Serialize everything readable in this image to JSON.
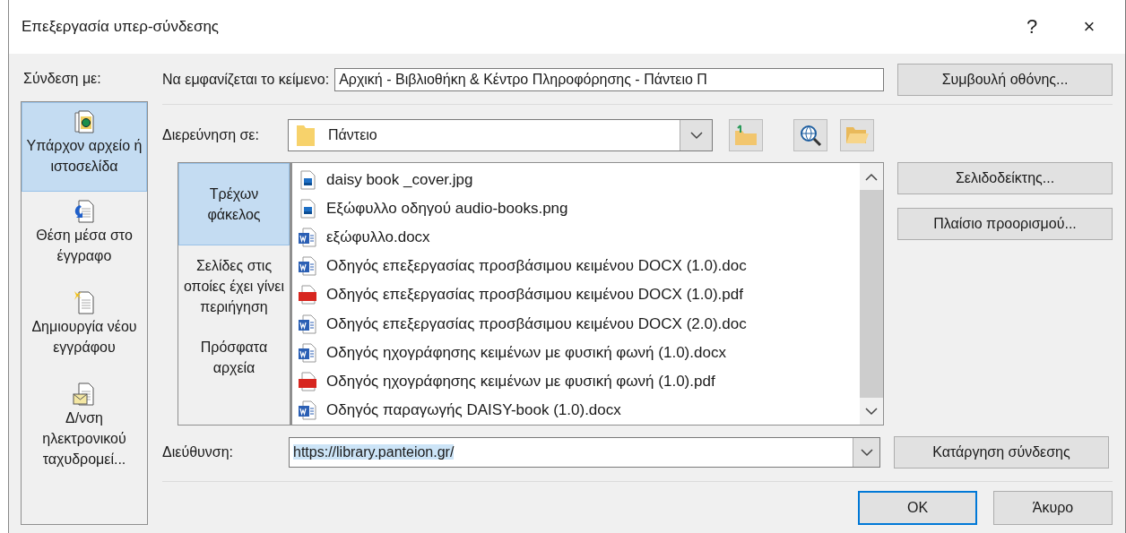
{
  "window": {
    "title": "Επεξεργασία υπερ-σύνδεσης",
    "help": "?",
    "close": "×"
  },
  "link_to": {
    "label": "Σύνδεση με:",
    "items": [
      {
        "label": "Υπάρχον αρχείο ή ιστοσελίδα",
        "kind": "web",
        "selected": true
      },
      {
        "label": "Θέση μέσα στο έγγραφο",
        "kind": "place",
        "selected": false
      },
      {
        "label": "Δημιουργία νέου εγγράφου",
        "kind": "new",
        "selected": false
      },
      {
        "label": "Δ/νση ηλεκτρονικού ταχυδρομεί...",
        "kind": "mail",
        "selected": false
      }
    ]
  },
  "display_text": {
    "label": "Να εμφανίζεται το κείμενο:",
    "value": "Αρχική - Βιβλιοθήκη & Κέντρο Πληροφόρησης - Πάντειο Π"
  },
  "screen_tip_button": "Συμβουλή οθόνης...",
  "look_in": {
    "label": "Διερεύνηση σε:",
    "value": "Πάντειο"
  },
  "nav": [
    {
      "label": "Τρέχων φάκελος",
      "selected": true
    },
    {
      "label": "Σελίδες στις οποίες έχει γίνει περιήγηση",
      "selected": false
    },
    {
      "label": "Πρόσφατα αρχεία",
      "selected": false
    }
  ],
  "files": [
    {
      "name": "daisy book _cover.jpg",
      "kind": "image"
    },
    {
      "name": "Εξώφυλλο οδηγού audio-books.png",
      "kind": "image"
    },
    {
      "name": "εξώφυλλο.docx",
      "kind": "word"
    },
    {
      "name": "Οδηγός επεξεργασίας προσβάσιμου κειμένου DOCX (1.0).doc",
      "kind": "word"
    },
    {
      "name": "Οδηγός επεξεργασίας προσβάσιμου κειμένου DOCX (1.0).pdf",
      "kind": "pdf"
    },
    {
      "name": "Οδηγός επεξεργασίας προσβάσιμου κειμένου DOCX (2.0).doc",
      "kind": "word"
    },
    {
      "name": "Οδηγός ηχογράφησης κειμένων με φυσική φωνή (1.0).docx",
      "kind": "word"
    },
    {
      "name": "Οδηγός ηχογράφησης κειμένων με φυσική φωνή (1.0).pdf",
      "kind": "pdf"
    },
    {
      "name": "Οδηγός παραγωγής DAISY-book (1.0).docx",
      "kind": "word"
    }
  ],
  "side_buttons": [
    "Σελιδοδείκτης...",
    "Πλαίσιο προορισμού..."
  ],
  "address": {
    "label": "Διεύθυνση:",
    "value": "https://library.panteion.gr/",
    "selected": true
  },
  "remove_link_button": "Κατάργηση σύνδεσης",
  "footer_buttons": [
    {
      "label": "OK",
      "default": true
    },
    {
      "label": "Άκυρο",
      "default": false
    }
  ]
}
